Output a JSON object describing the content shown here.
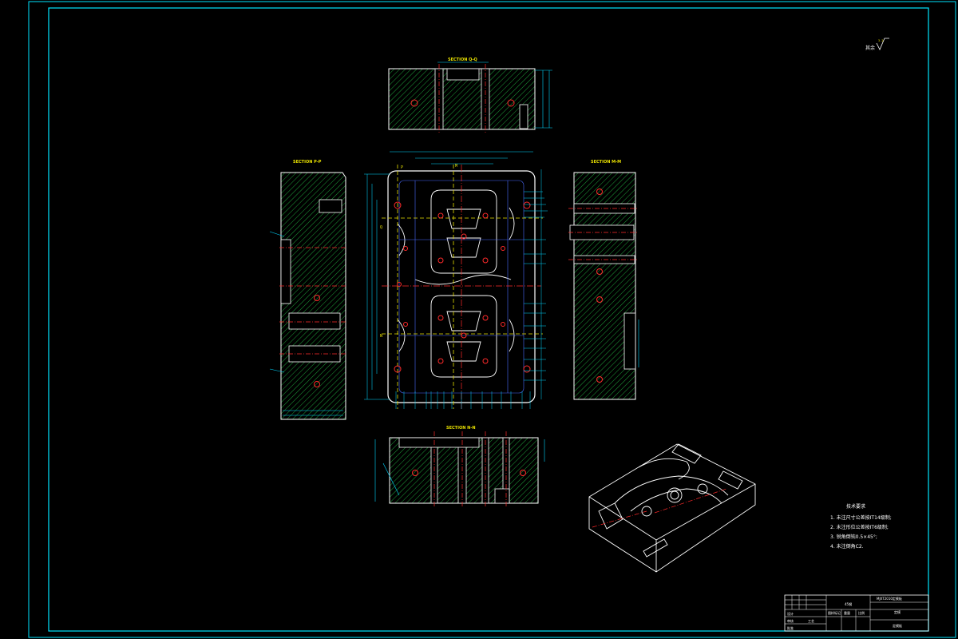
{
  "colors": {
    "background": "#000000",
    "border": "#00e5ff",
    "outline": "#ffffff",
    "hatch": "#1e9f3a",
    "centerline": "#ff2a2a",
    "dimension": "#00d7ff",
    "label": "#e8e000",
    "hidden": "#4a6bff"
  },
  "sections": {
    "top": "SECTION Q-Q",
    "left": "SECTION P-P",
    "right": "SECTION M-M",
    "bottom": "SECTION N-N"
  },
  "plan_markers": {
    "p": "P",
    "q": "Q",
    "n": "N",
    "m": "M"
  },
  "roughness": {
    "prefix": "其余",
    "value": "3.2"
  },
  "notes": {
    "title": "技术要求",
    "items": [
      "1. 未注尺寸公差按IT14级制;",
      "2. 未注形位公差按IT6级制;",
      "3. 锐角倒钝0.5×45°;",
      "4. 未注倒角C2."
    ]
  },
  "title_block": {
    "material": "45钢",
    "drawing_no": "MJXT2010定模板",
    "name": "定模",
    "part": "定模板",
    "roles": [
      "设计",
      "审核",
      "工艺",
      "批准"
    ],
    "meta": [
      "图样标记",
      "重量",
      "比例"
    ]
  }
}
